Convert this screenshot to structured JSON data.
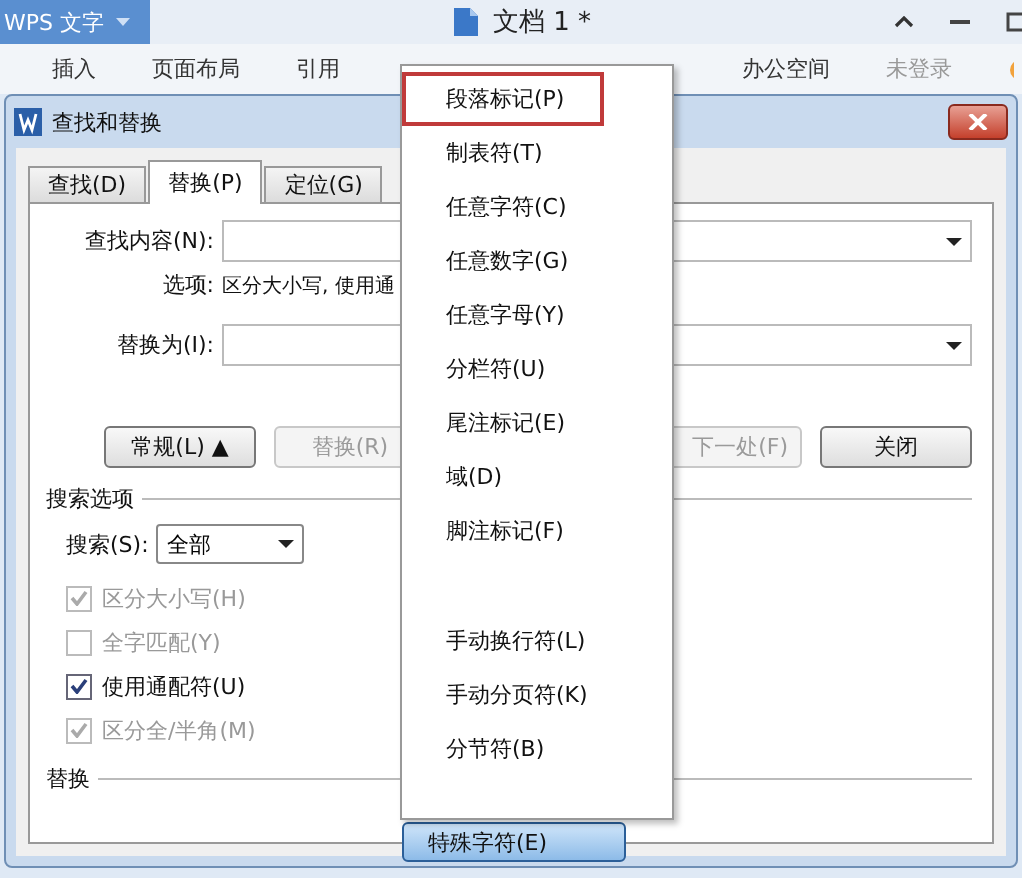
{
  "app": {
    "name": "WPS 文字",
    "document_title": "文档 1 *"
  },
  "ribbon_tabs": [
    {
      "label": "插入"
    },
    {
      "label": "页面布局"
    },
    {
      "label": "引用"
    },
    {
      "kind": "gap"
    },
    {
      "label": "办公空间"
    }
  ],
  "login": "未登录",
  "dialog": {
    "title": "查找和替换",
    "tabs": [
      {
        "label": "查找(D)",
        "selected": false
      },
      {
        "label": "替换(P)",
        "selected": true
      },
      {
        "label": "定位(G)",
        "selected": false
      }
    ],
    "find_label": "查找内容(N):",
    "options_label": "选项:",
    "options_value": "区分大小写, 使用通",
    "replace_label": "替换为(I):",
    "buttons": [
      {
        "label": "常规(L) ▲",
        "disabled": false
      },
      {
        "label": "替换(R)",
        "disabled": true
      },
      {
        "label": "下一处(F)",
        "disabled": true
      },
      {
        "label": "关闭",
        "disabled": false
      }
    ],
    "search_options_title": "搜索选项",
    "search_label": "搜索(S):",
    "search_value": "全部",
    "checkboxes": [
      {
        "label": "区分大小写(H)",
        "checked": true,
        "disabled": true
      },
      {
        "label": "全字匹配(Y)",
        "checked": false,
        "disabled": true
      },
      {
        "label": "使用通配符(U)",
        "checked": true,
        "disabled": false
      },
      {
        "label": "区分全/半角(M)",
        "checked": true,
        "disabled": true
      }
    ],
    "replace_section_title": "替换",
    "special_button": "特殊字符(E)"
  },
  "menu": [
    {
      "kind": "item",
      "label": "段落标记(P)",
      "selected": true
    },
    {
      "kind": "item",
      "label": "制表符(T)",
      "selected": false
    },
    {
      "kind": "item",
      "label": "任意字符(C)",
      "selected": false
    },
    {
      "kind": "item",
      "label": "任意数字(G)",
      "selected": false
    },
    {
      "kind": "item",
      "label": "任意字母(Y)",
      "selected": false
    },
    {
      "kind": "item",
      "label": "分栏符(U)",
      "selected": false
    },
    {
      "kind": "item",
      "label": "尾注标记(E)",
      "selected": false
    },
    {
      "kind": "item",
      "label": "域(D)",
      "selected": false
    },
    {
      "kind": "item",
      "label": "脚注标记(F)",
      "selected": false
    },
    {
      "kind": "gap"
    },
    {
      "kind": "item",
      "label": "手动换行符(L)",
      "selected": false
    },
    {
      "kind": "item",
      "label": "手动分页符(K)",
      "selected": false
    },
    {
      "kind": "item",
      "label": "分节符(B)",
      "selected": false
    }
  ]
}
